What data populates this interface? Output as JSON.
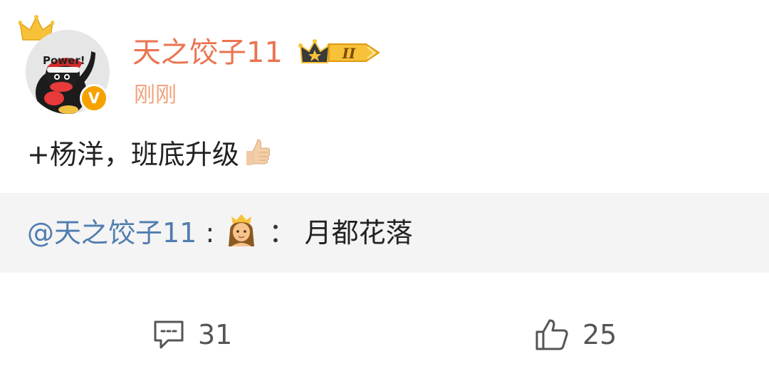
{
  "author": {
    "avatar_text": "Power!",
    "name": "天之饺子11",
    "verified_badge": "V",
    "vip_level": "II",
    "timestamp": "刚刚"
  },
  "post": {
    "text": "+杨洋，班底升级",
    "trailing_emoji": "thumbs-up-icon"
  },
  "repost": {
    "mention": "@天之饺子11",
    "colon": ":",
    "emoji": "princess-icon",
    "colon2": "：",
    "text": "月都花落"
  },
  "actions": {
    "comment_count": "31",
    "like_count": "25"
  },
  "colors": {
    "username": "#eb7350",
    "timestamp": "#f0a37f",
    "mention": "#507daf",
    "repost_bg": "#f4f4f4",
    "verified_badge": "#f5a200",
    "vip_gold": "#f7c23a"
  }
}
